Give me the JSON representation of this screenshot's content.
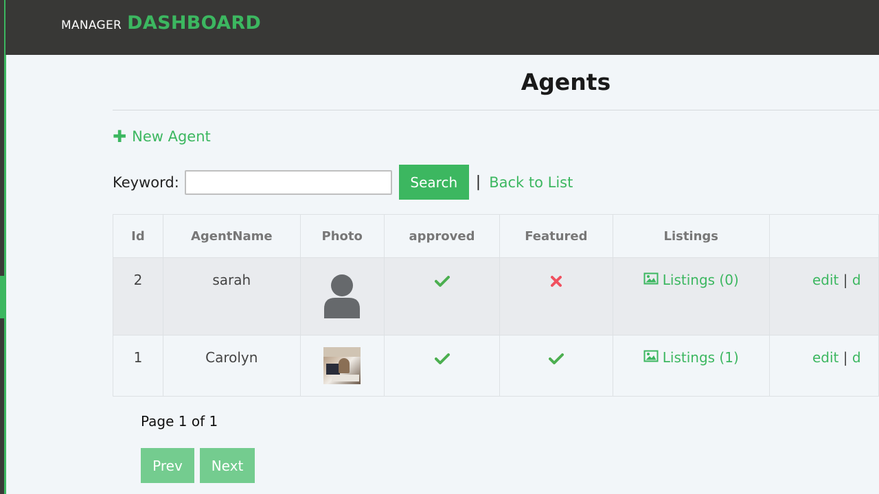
{
  "header": {
    "brand_small": "MANAGER",
    "brand_big": "DASHBOARD"
  },
  "page": {
    "title": "Agents",
    "new_agent_label": "New Agent"
  },
  "search": {
    "label": "Keyword:",
    "value": "",
    "button_label": "Search",
    "separator": "|",
    "back_label": "Back to List"
  },
  "table": {
    "columns": [
      "Id",
      "AgentName",
      "Photo",
      "approved",
      "Featured",
      "Listings",
      ""
    ],
    "rows": [
      {
        "id": "2",
        "name": "sarah",
        "photo": "default-avatar-icon",
        "approved": "check",
        "featured": "cross",
        "listings_label": "Listings (0)",
        "edit_label": "edit",
        "sep": "|",
        "more_label": "d"
      },
      {
        "id": "1",
        "name": "Carolyn",
        "photo": "agent-photo",
        "approved": "check",
        "featured": "check",
        "listings_label": "Listings (1)",
        "edit_label": "edit",
        "sep": "|",
        "more_label": "d"
      }
    ]
  },
  "pagination": {
    "info": "Page 1 of 1",
    "prev_label": "Prev",
    "next_label": "Next"
  },
  "colors": {
    "accent": "#3cb760",
    "header_bg": "#383836",
    "check": "#4caf50",
    "cross": "#f0505f"
  }
}
